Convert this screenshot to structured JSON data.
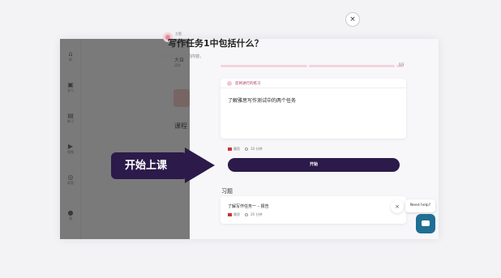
{
  "sidebar": {
    "items": [
      {
        "label": "家",
        "icon": "home-icon"
      },
      {
        "label": "学习",
        "icon": "book-icon"
      },
      {
        "label": "练习",
        "icon": "practice-icon"
      },
      {
        "label": "视频",
        "icon": "video-icon"
      },
      {
        "label": "发现",
        "icon": "compass-icon"
      },
      {
        "label": "我",
        "icon": "profile-icon"
      }
    ]
  },
  "background": {
    "section_label": "大自",
    "subtext": "读你",
    "heading": "课程"
  },
  "topic": {
    "label": "主题",
    "title": "写作任务1中包括什么？",
    "description": "了解写作任务1的内容。",
    "progress_segments": [
      0,
      0,
      1
    ],
    "progress_count": "0/3"
  },
  "lesson_card": {
    "recommend_label": "您将进行的练习",
    "title": "了解雅思写作测试中的两个任务",
    "level": "雅思",
    "duration": "10 分钟",
    "start_label": "开始"
  },
  "exercise": {
    "section_title": "习题",
    "title": "了解写作任务一 – 报告",
    "level": "雅思",
    "duration": "20 分钟"
  },
  "callout": {
    "label": "开始上课"
  },
  "help": {
    "bubble": "Need help?",
    "dismiss": "×"
  },
  "close": {
    "label": "×"
  },
  "colors": {
    "accent": "#2b1a4a",
    "progress": "#f2d4db",
    "chat": "#1f6f93"
  }
}
